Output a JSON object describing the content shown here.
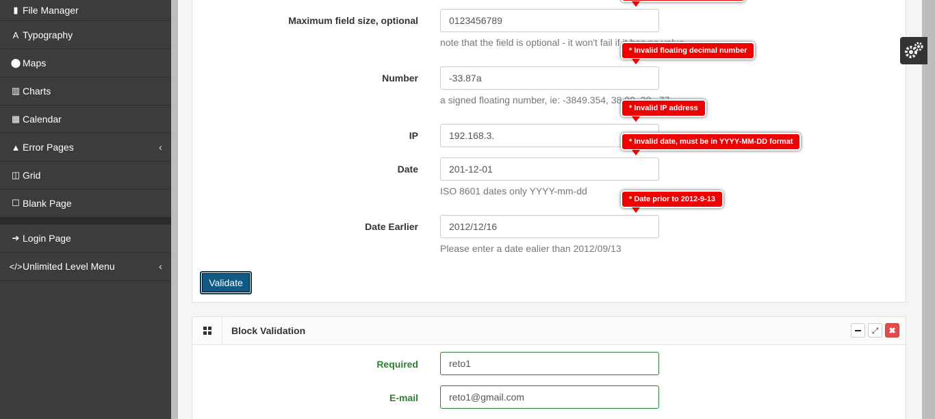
{
  "sidebar": {
    "items": [
      {
        "icon": "file-icon",
        "glyph": "▮",
        "label": "File Manager",
        "chevron": ""
      },
      {
        "icon": "font-icon",
        "glyph": "A",
        "label": "Typography",
        "chevron": ""
      },
      {
        "icon": "map-marker-icon",
        "glyph": "⬤",
        "label": "Maps",
        "chevron": ""
      },
      {
        "icon": "bar-chart-icon",
        "glyph": "▥",
        "label": "Charts",
        "chevron": ""
      },
      {
        "icon": "calendar-icon",
        "glyph": "▦",
        "label": "Calendar",
        "chevron": ""
      },
      {
        "icon": "warning-icon",
        "glyph": "▲",
        "label": "Error Pages",
        "chevron": "‹"
      },
      {
        "icon": "columns-icon",
        "glyph": "◫",
        "label": "Grid",
        "chevron": ""
      },
      {
        "icon": "square-icon",
        "glyph": "☐",
        "label": "Blank Page",
        "chevron": ""
      }
    ],
    "items2": [
      {
        "icon": "sign-in-icon",
        "glyph": "➔",
        "label": "Login Page",
        "chevron": ""
      },
      {
        "icon": "code-icon",
        "glyph": "</>",
        "label": "Unlimited Level Menu",
        "chevron": "‹"
      }
    ]
  },
  "form": {
    "max_size": {
      "label": "Maximum field size, optional",
      "value": "0123456789",
      "help": "note that the field is optional - it won't fail if it has no value"
    },
    "number": {
      "label": "Number",
      "value": "-33.87a",
      "help": "a signed floating number, ie: -3849.354, 38.00, 38, .77",
      "error": "* Invalid floating decimal number"
    },
    "ip": {
      "label": "IP",
      "value": "192.168.3.",
      "error": "* Invalid IP address"
    },
    "date": {
      "label": "Date",
      "value": "201-12-01",
      "help": "ISO 8601 dates only YYYY-mm-dd",
      "error": "* Invalid date, must be in YYYY-MM-DD format"
    },
    "date_earlier": {
      "label": "Date Earlier",
      "value": "2012/12/16",
      "help": "Please enter a date ealier than 2012/09/13",
      "error": "* Date prior to 2012-9-13"
    },
    "validate_label": "Validate"
  },
  "block": {
    "title": "Block Validation",
    "required": {
      "label": "Required",
      "value": "reto1"
    },
    "email": {
      "label": "E-mail",
      "value": "reto1@gmail.com"
    }
  }
}
